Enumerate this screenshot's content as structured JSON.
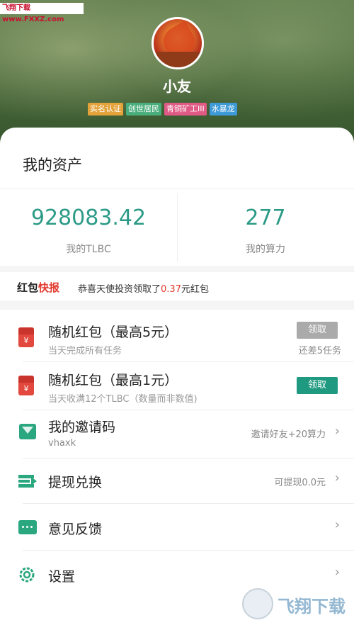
{
  "watermark": {
    "text": "飞翔下载 www.FXXZ.com",
    "brand": "飞翔下载"
  },
  "profile": {
    "name": "小友",
    "tags": [
      {
        "label": "实名认证",
        "color": "#e3a23a"
      },
      {
        "label": "创世居民",
        "color": "#4aae7c"
      },
      {
        "label": "青铜矿工III",
        "color": "#e05a86"
      },
      {
        "label": "水暴龙",
        "color": "#3e9ad6"
      }
    ]
  },
  "assets": {
    "title": "我的资产",
    "tlbc": {
      "value": "928083.42",
      "label": "我的TLBC"
    },
    "power": {
      "value": "277",
      "label": "我的算力"
    }
  },
  "news": {
    "logo_a": "红包",
    "logo_b": "快报",
    "text_prefix": "恭喜天使投资领取了",
    "amount": "0.37",
    "text_suffix": "元红包"
  },
  "list": {
    "item1": {
      "title": "随机红包（最高5元）",
      "subtitle": "当天完成所有任务",
      "button": "领取",
      "right": "还差5任务"
    },
    "item2": {
      "title": "随机红包（最高1元）",
      "subtitle": "当天收满12个TLBC（数量而非数值)",
      "button": "领取"
    },
    "invite": {
      "title": "我的邀请码",
      "code": "vhaxk",
      "right": "邀请好友+20算力"
    },
    "withdraw": {
      "title": "提现兑换",
      "right": "可提现0.0元"
    },
    "feedback": {
      "title": "意见反馈"
    },
    "settings": {
      "title": "设置"
    }
  },
  "icons": {
    "redpacket": "red-envelope-icon",
    "invite": "invite-icon",
    "withdraw": "withdraw-icon",
    "feedback": "chat-icon",
    "settings": "gear-icon"
  },
  "colors": {
    "accent": "#2b9a86",
    "button_disabled": "#aaaaaa",
    "button_active": "#1f9a80",
    "red": "#e2483d"
  }
}
